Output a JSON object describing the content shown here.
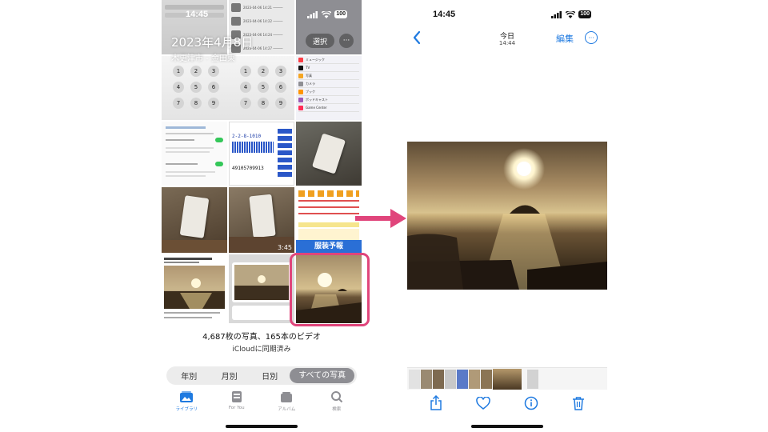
{
  "left_phone": {
    "status": {
      "time": "14:45",
      "battery": "100"
    },
    "header": {
      "date_title": "2023年4月8日",
      "location": "木更津市 - 金田東",
      "select_label": "選択",
      "more_label": "···"
    },
    "grid": {
      "video_duration": "3:45",
      "weather_banner": "服装予報",
      "dial_keys": [
        "1",
        "2",
        "3",
        "4",
        "5",
        "6",
        "7",
        "8",
        "9"
      ],
      "settings_items": [
        "ミュージック",
        "TV",
        "写真",
        "カメラ",
        "ブック",
        "ポッドキャスト",
        "Game Center"
      ],
      "ticket_lines": [
        "2-2-8-1010",
        "49105709913"
      ]
    },
    "library_info": {
      "counts": "4,687枚の写真、165本のビデオ",
      "sync": "iCloudに同期済み"
    },
    "segments": [
      "年別",
      "月別",
      "日別",
      "すべての写真"
    ],
    "active_segment": "すべての写真",
    "tabs": [
      {
        "label": "ライブラリ",
        "icon": "photo-library-icon",
        "active": true
      },
      {
        "label": "For You",
        "icon": "for-you-icon",
        "active": false
      },
      {
        "label": "アルバム",
        "icon": "albums-icon",
        "active": false
      },
      {
        "label": "検索",
        "icon": "search-icon",
        "active": false
      }
    ],
    "highlight_color": "#e0457b"
  },
  "right_phone": {
    "status": {
      "time": "14:45",
      "battery": "100"
    },
    "nav": {
      "title": "今日",
      "subtitle": "14:44",
      "edit_label": "編集",
      "more_label": "···"
    },
    "toolbar": [
      "share-icon",
      "heart-icon",
      "info-icon",
      "trash-icon"
    ]
  },
  "colors": {
    "accent": "#1f7ae0",
    "arrow": "#e0457b"
  }
}
